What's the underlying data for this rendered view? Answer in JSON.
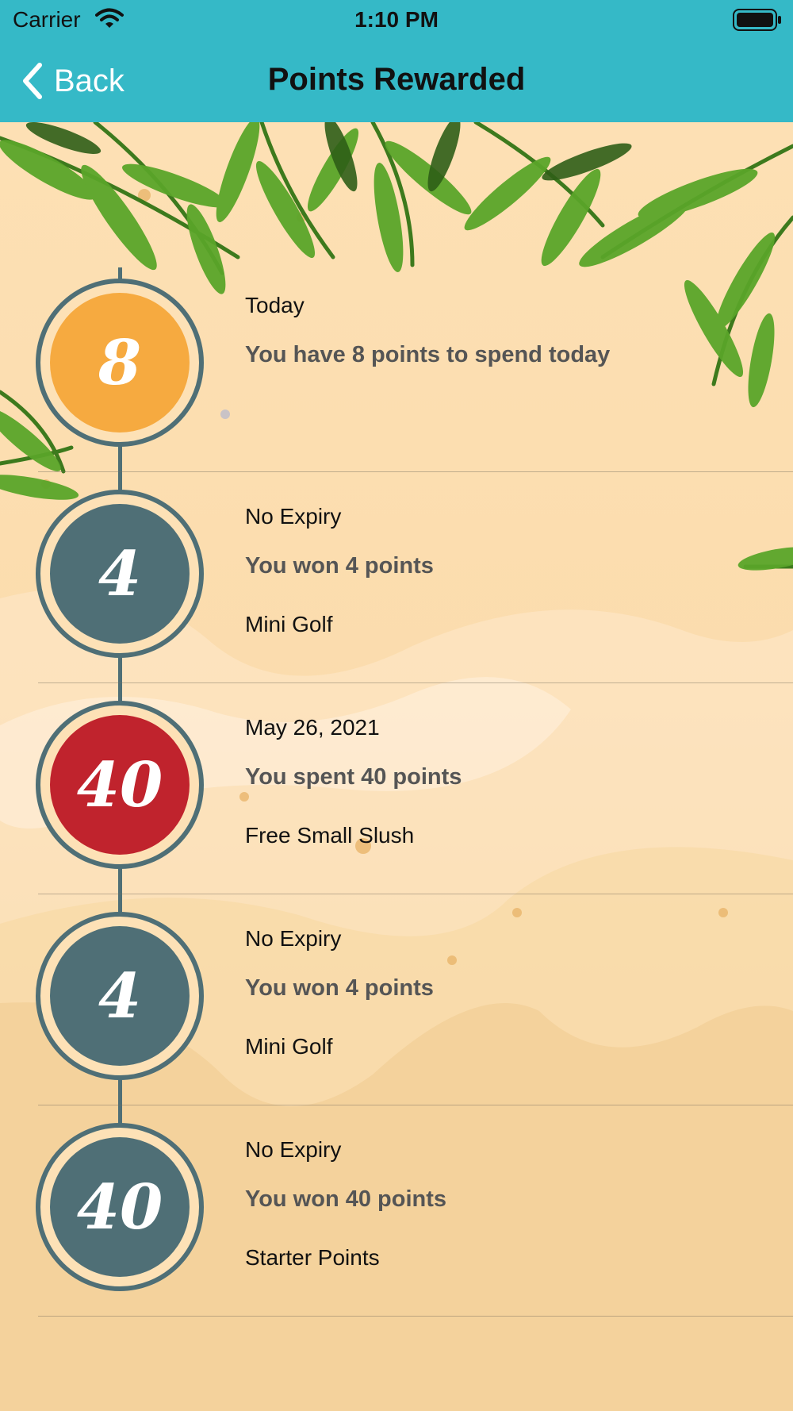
{
  "status_bar": {
    "carrier": "Carrier",
    "time": "1:10 PM"
  },
  "nav": {
    "back_label": "Back",
    "title": "Points Rewarded"
  },
  "colors": {
    "header": "#35b9c7",
    "timeline": "#4f6f76",
    "orange": "#f6aa40",
    "red": "#c0232d",
    "sand": "#f4d59f"
  },
  "entries": [
    {
      "points": "8",
      "kind": "balance",
      "date": "Today",
      "message": "You have 8 points to spend today",
      "detail": ""
    },
    {
      "points": "4",
      "kind": "won",
      "date": "No Expiry",
      "message": "You won 4 points",
      "detail": "Mini Golf"
    },
    {
      "points": "40",
      "kind": "spent",
      "date": "May 26, 2021",
      "message": "You spent 40 points",
      "detail": "Free Small Slush"
    },
    {
      "points": "4",
      "kind": "won",
      "date": "No Expiry",
      "message": "You won 4 points",
      "detail": "Mini Golf"
    },
    {
      "points": "40",
      "kind": "won",
      "date": "No Expiry",
      "message": "You won 40 points",
      "detail": "Starter Points"
    }
  ]
}
